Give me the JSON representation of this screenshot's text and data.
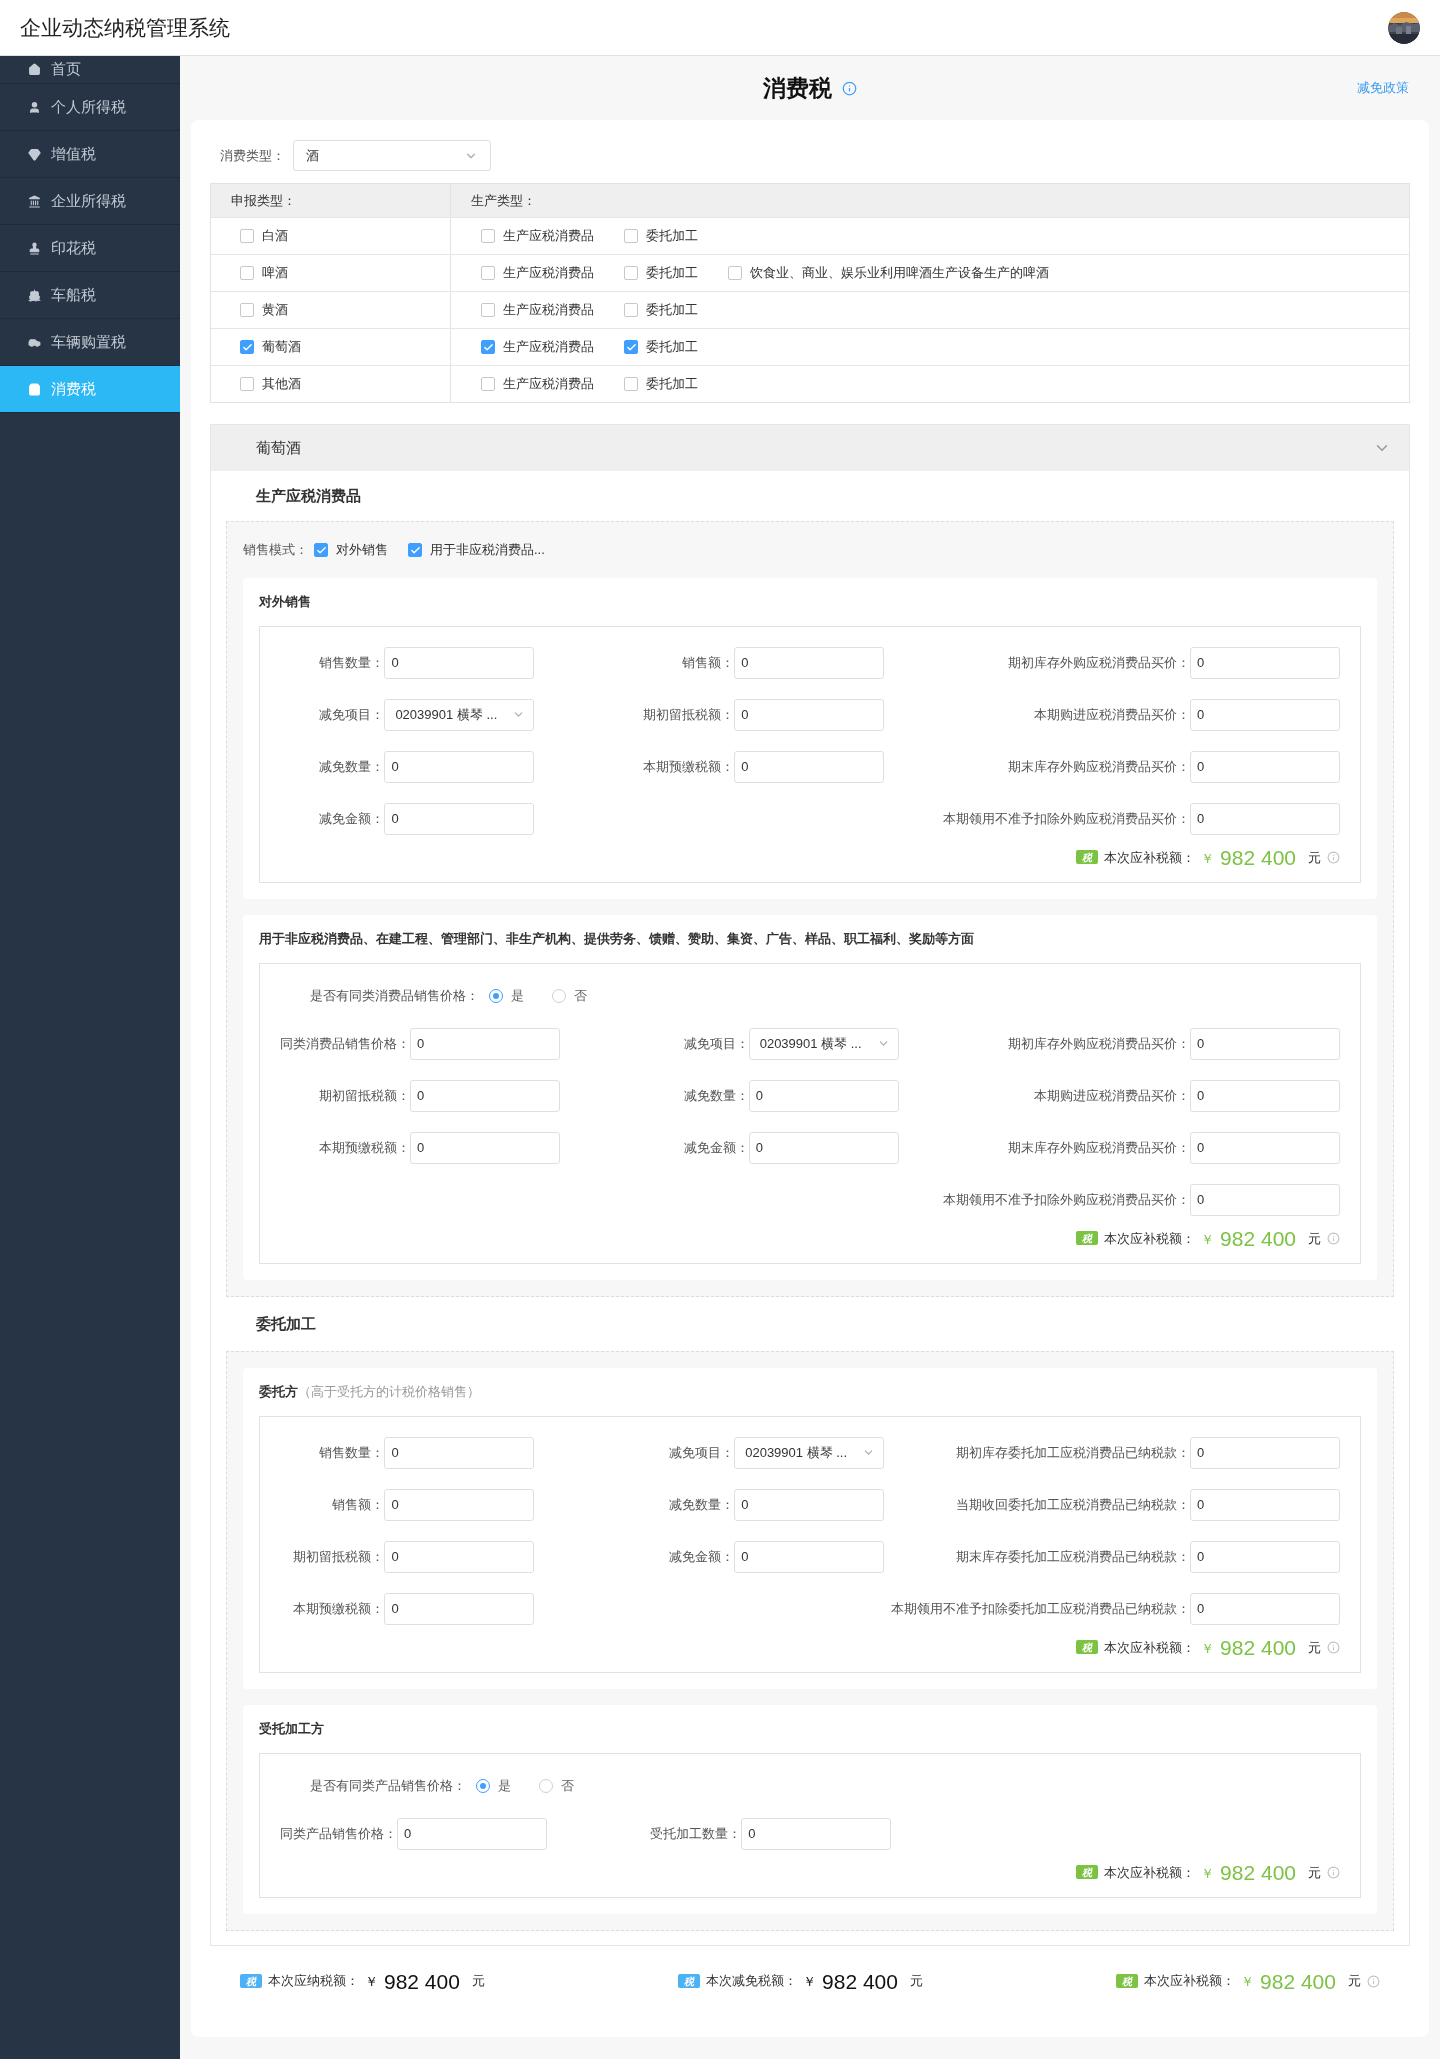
{
  "app": {
    "title": "企业动态纳税管理系统"
  },
  "sidebar": {
    "items": [
      {
        "label": "首页",
        "selected": false
      },
      {
        "label": "个人所得税",
        "selected": false
      },
      {
        "label": "增值税",
        "selected": false
      },
      {
        "label": "企业所得税",
        "selected": false
      },
      {
        "label": "印花税",
        "selected": false
      },
      {
        "label": "车船税",
        "selected": false
      },
      {
        "label": "车辆购置税",
        "selected": false
      },
      {
        "label": "消费税",
        "selected": true
      }
    ]
  },
  "page": {
    "title": "消费税",
    "link": "减免政策"
  },
  "consumption_type": {
    "label": "消费类型：",
    "value": "酒"
  },
  "declare_table": {
    "columns": [
      "申报类型：",
      "生产类型："
    ],
    "rows": [
      {
        "type": {
          "label": "白酒",
          "checked": false
        },
        "production": [
          {
            "label": "生产应税消费品",
            "checked": false
          },
          {
            "label": "委托加工",
            "checked": false
          }
        ]
      },
      {
        "type": {
          "label": "啤酒",
          "checked": false
        },
        "production": [
          {
            "label": "生产应税消费品",
            "checked": false
          },
          {
            "label": "委托加工",
            "checked": false
          },
          {
            "label": "饮食业、商业、娱乐业利用啤酒生产设备生产的啤酒",
            "checked": false
          }
        ]
      },
      {
        "type": {
          "label": "黄酒",
          "checked": false
        },
        "production": [
          {
            "label": "生产应税消费品",
            "checked": false
          },
          {
            "label": "委托加工",
            "checked": false
          }
        ]
      },
      {
        "type": {
          "label": "葡萄酒",
          "checked": true
        },
        "production": [
          {
            "label": "生产应税消费品",
            "checked": true
          },
          {
            "label": "委托加工",
            "checked": true
          }
        ]
      },
      {
        "type": {
          "label": "其他酒",
          "checked": false
        },
        "production": [
          {
            "label": "生产应税消费品",
            "checked": false
          },
          {
            "label": "委托加工",
            "checked": false
          }
        ]
      }
    ]
  },
  "section": {
    "title": "葡萄酒"
  },
  "production": {
    "title": "生产应税消费品",
    "sales_mode": {
      "label": "销售模式：",
      "options": [
        {
          "label": "对外销售",
          "checked": true
        },
        {
          "label": "用于非应税消费品...",
          "checked": true
        }
      ]
    },
    "external_sales": {
      "title": "对外销售",
      "columns": [
        [
          {
            "label": "销售数量：",
            "value": "0",
            "kind": "input"
          },
          {
            "label": "减免项目：",
            "value": "02039901 横琴 ...",
            "kind": "select"
          },
          {
            "label": "减免数量：",
            "value": "0",
            "kind": "input"
          },
          {
            "label": "减免金额：",
            "value": "0",
            "kind": "input"
          }
        ],
        [
          {
            "label": "销售额：",
            "value": "0",
            "kind": "input"
          },
          {
            "label": "期初留抵税额：",
            "value": "0",
            "kind": "input"
          },
          {
            "label": "本期预缴税额：",
            "value": "0",
            "kind": "input"
          }
        ],
        [
          {
            "label": "期初库存外购应税消费品买价：",
            "value": "0",
            "kind": "input"
          },
          {
            "label": "本期购进应税消费品买价：",
            "value": "0",
            "kind": "input"
          },
          {
            "label": "期末库存外购应税消费品买价：",
            "value": "0",
            "kind": "input"
          },
          {
            "label": "本期领用不准予扣除外购应税消费品买价：",
            "value": "0",
            "kind": "input"
          }
        ]
      ],
      "total": {
        "badge": "税",
        "label": "本次应补税额：",
        "currency": "￥",
        "amount": "982 400",
        "unit": "元"
      }
    },
    "non_taxable": {
      "title": "用于非应税消费品、在建工程、管理部门、非生产机构、提供劳务、馈赠、赞助、集资、广告、样品、职工福利、奖励等方面",
      "question": {
        "label": "是否有同类消费品销售价格：",
        "options": [
          {
            "label": "是",
            "selected": true
          },
          {
            "label": "否",
            "selected": false
          }
        ]
      },
      "columns": [
        [
          {
            "label": "同类消费品销售价格：",
            "value": "0",
            "kind": "input"
          },
          {
            "label": "期初留抵税额：",
            "value": "0",
            "kind": "input"
          },
          {
            "label": "本期预缴税额：",
            "value": "0",
            "kind": "input"
          }
        ],
        [
          {
            "label": "减免项目：",
            "value": "02039901 横琴 ...",
            "kind": "select"
          },
          {
            "label": "减免数量：",
            "value": "0",
            "kind": "input"
          },
          {
            "label": "减免金额：",
            "value": "0",
            "kind": "input"
          }
        ],
        [
          {
            "label": "期初库存外购应税消费品买价：",
            "value": "0",
            "kind": "input"
          },
          {
            "label": "本期购进应税消费品买价：",
            "value": "0",
            "kind": "input"
          },
          {
            "label": "期末库存外购应税消费品买价：",
            "value": "0",
            "kind": "input"
          },
          {
            "label": "本期领用不准予扣除外购应税消费品买价：",
            "value": "0",
            "kind": "input"
          }
        ]
      ],
      "total": {
        "badge": "税",
        "label": "本次应补税额：",
        "currency": "￥",
        "amount": "982 400",
        "unit": "元"
      }
    }
  },
  "processing": {
    "title": "委托加工",
    "entrustor": {
      "title": "委托方",
      "note": "（高于受托方的计税价格销售）",
      "columns": [
        [
          {
            "label": "销售数量：",
            "value": "0",
            "kind": "input"
          },
          {
            "label": "销售额：",
            "value": "0",
            "kind": "input"
          },
          {
            "label": "期初留抵税额：",
            "value": "0",
            "kind": "input"
          },
          {
            "label": "本期预缴税额：",
            "value": "0",
            "kind": "input"
          }
        ],
        [
          {
            "label": "减免项目：",
            "value": "02039901 横琴 ...",
            "kind": "select"
          },
          {
            "label": "减免数量：",
            "value": "0",
            "kind": "input"
          },
          {
            "label": "减免金额：",
            "value": "0",
            "kind": "input"
          }
        ],
        [
          {
            "label": "期初库存委托加工应税消费品已纳税款：",
            "value": "0",
            "kind": "input"
          },
          {
            "label": "当期收回委托加工应税消费品已纳税款：",
            "value": "0",
            "kind": "input"
          },
          {
            "label": "期末库存委托加工应税消费品已纳税款：",
            "value": "0",
            "kind": "input"
          },
          {
            "label": "本期领用不准予扣除委托加工应税消费品已纳税款：",
            "value": "0",
            "kind": "input"
          }
        ]
      ],
      "total": {
        "badge": "税",
        "label": "本次应补税额：",
        "currency": "￥",
        "amount": "982 400",
        "unit": "元"
      }
    },
    "processor": {
      "title": "受托加工方",
      "question": {
        "label": "是否有同类产品销售价格：",
        "options": [
          {
            "label": "是",
            "selected": true
          },
          {
            "label": "否",
            "selected": false
          }
        ]
      },
      "columns": [
        [
          {
            "label": "同类产品销售价格：",
            "value": "0",
            "kind": "input"
          }
        ],
        [
          {
            "label": "受托加工数量：",
            "value": "0",
            "kind": "input"
          }
        ]
      ],
      "total": {
        "badge": "税",
        "label": "本次应补税额：",
        "currency": "￥",
        "amount": "982 400",
        "unit": "元"
      }
    }
  },
  "summary": [
    {
      "kind": "due",
      "badge": "税",
      "label": "本次应纳税额：",
      "currency": "￥",
      "amount": "982 400",
      "unit": "元"
    },
    {
      "kind": "relief",
      "badge": "税",
      "label": "本次减免税额：",
      "currency": "￥",
      "amount": "982 400",
      "unit": "元"
    },
    {
      "kind": "supplement",
      "badge": "税",
      "label": "本次应补税额：",
      "currency": "￥",
      "amount": "982 400",
      "unit": "元"
    }
  ]
}
